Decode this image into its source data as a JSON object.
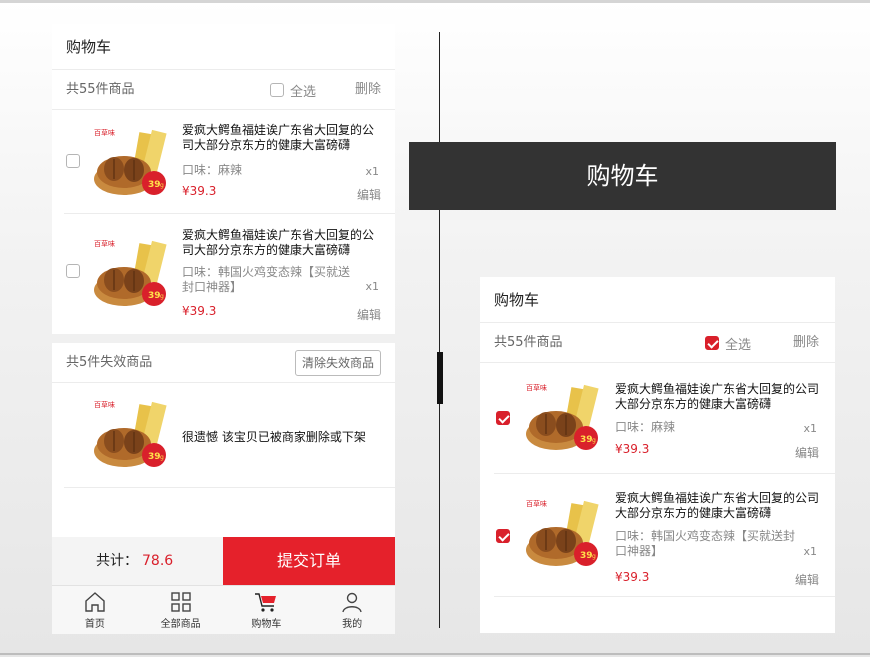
{
  "left_cart": {
    "title": "购物车",
    "count_text": "共55件商品",
    "select_all_label": "全选",
    "delete_label": "删除",
    "items": [
      {
        "title": "爱疯大鳄鱼福娃诶广东省大回复的公司大部分京东方的健康大富磅礴",
        "flavor": "口味：麻辣",
        "price": "¥39.3",
        "qty": "x1",
        "edit_label": "编辑",
        "checked": false
      },
      {
        "title": "爱疯大鳄鱼福娃诶广东省大回复的公司大部分京东方的健康大富磅礴",
        "flavor": "口味：韩国火鸡变态辣【买就送封口神器】",
        "price": "¥39.3",
        "qty": "x1",
        "edit_label": "编辑",
        "checked": false
      }
    ],
    "invalid": {
      "count_text": "共5件失效商品",
      "clear_label": "清除失效商品",
      "message": "很遗憾 该宝贝已被商家删除或下架"
    },
    "footer": {
      "total_label": "共计：",
      "total_amount": "78.6",
      "submit_label": "提交订单"
    },
    "tabs": [
      {
        "label": "首页",
        "icon": "home-icon"
      },
      {
        "label": "全部商品",
        "icon": "grid-icon"
      },
      {
        "label": "购物车",
        "icon": "cart-icon"
      },
      {
        "label": "我的",
        "icon": "user-icon"
      }
    ]
  },
  "banner": {
    "title": "购物车"
  },
  "right_cart": {
    "title": "购物车",
    "count_text": "共55件商品",
    "select_all_label": "全选",
    "delete_label": "删除",
    "items": [
      {
        "title": "爱疯大鳄鱼福娃诶广东省大回复的公司大部分京东方的健康大富磅礴",
        "flavor": "口味：麻辣",
        "price": "¥39.3",
        "qty": "x1",
        "edit_label": "编辑",
        "checked": true
      },
      {
        "title": "爱疯大鳄鱼福娃诶广东省大回复的公司大部分京东方的健康大富磅礴",
        "flavor": "口味：韩国火鸡变态辣【买就送封口神器】",
        "price": "¥39.3",
        "qty": "x1",
        "edit_label": "编辑",
        "checked": true
      }
    ]
  },
  "product_image": {
    "brand": "百草味",
    "badge_price": "39",
    "badge_unit": "g"
  },
  "colors": {
    "accent": "#e5212b",
    "banner": "#333333"
  }
}
